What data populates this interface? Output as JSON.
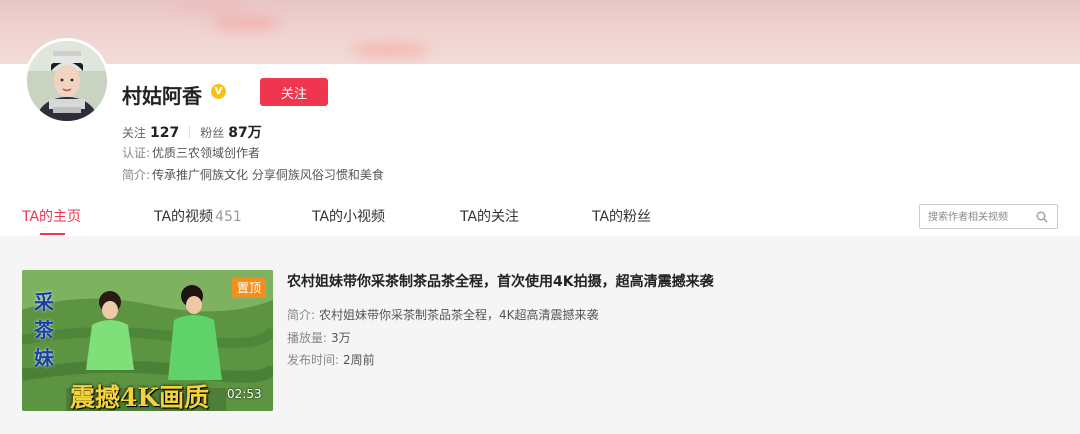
{
  "profile": {
    "name": "村姑阿香",
    "verified_badge": "V",
    "follow_label": "关注",
    "following_label": "关注",
    "following_count": "127",
    "fans_label": "粉丝",
    "fans_count": "87万",
    "cert_label": "认证:",
    "cert_value": "优质三农领域创作者",
    "intro_label": "简介:",
    "intro_value": "传承推广侗族文化 分享侗族风俗习惯和美食"
  },
  "tabs": [
    {
      "label": "TA的主页",
      "count": ""
    },
    {
      "label": "TA的视频",
      "count": "451"
    },
    {
      "label": "TA的小视频",
      "count": ""
    },
    {
      "label": "TA的关注",
      "count": ""
    },
    {
      "label": "TA的粉丝",
      "count": ""
    }
  ],
  "search": {
    "placeholder": "搜索作者相关视频"
  },
  "video": {
    "thumb_text_vertical": "采茶妹",
    "thumb_text_bottom": "震撼4K画质",
    "pin_label": "置顶",
    "duration": "02:53",
    "title": "农村姐妹带你采茶制茶品茶全程，首次使用4K拍摄，超高清震撼来袭",
    "intro_label": "简介:",
    "intro_value": "农村姐妹带你采茶制茶品茶全程，4K超高清震撼来袭",
    "plays_label": "播放量:",
    "plays_value": "3万",
    "time_label": "发布时间:",
    "time_value": "2周前"
  },
  "colors": {
    "accent": "#f0364f",
    "pin": "#f1901e",
    "verified": "#f7c11a"
  },
  "icons": [
    "verified-icon",
    "search-icon"
  ]
}
